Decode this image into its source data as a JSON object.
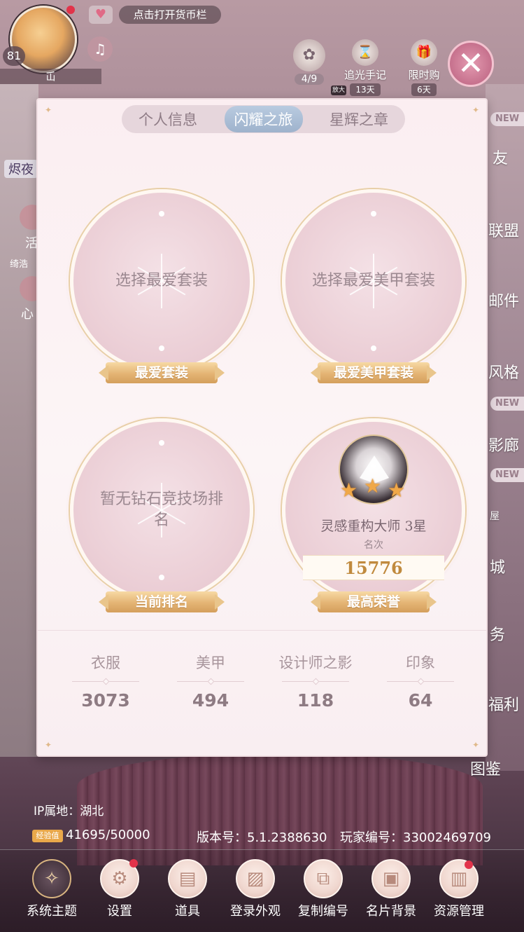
{
  "hud": {
    "level": "81",
    "player_name": "屲",
    "currency_button": "点击打开货币栏",
    "quest_count": "4/9",
    "zoom_label": "放大",
    "event1": {
      "label": "追光手记",
      "sub": "13天"
    },
    "event2": {
      "label": "限时购",
      "sub": "6天"
    }
  },
  "left_side": {
    "item1": "烬夜",
    "item2": "活",
    "item3": "绮浩",
    "item4": "心"
  },
  "right_side": {
    "items": [
      "友",
      "联盟",
      "邮件",
      "风格",
      "影廊",
      "屋",
      "城",
      "务",
      "福利",
      "图鉴"
    ],
    "new_tag": "NEW"
  },
  "tabs": {
    "personal": "个人信息",
    "journey": "闪耀之旅",
    "badges": "星辉之章"
  },
  "slots": {
    "favorite_suit": {
      "text": "选择最爱套装",
      "ribbon": "最爱套装"
    },
    "favorite_nail": {
      "text": "选择最爱美甲套装",
      "ribbon": "最爱美甲套装"
    },
    "current_rank": {
      "text": "暂无钻石竞技场排名",
      "ribbon": "当前排名"
    },
    "top_honor": {
      "title": "灵感重构大师 3星",
      "sub": "名次",
      "rank": "15776",
      "ribbon": "最高荣誉",
      "stars": 3
    }
  },
  "stats": [
    {
      "label": "衣服",
      "value": "3073"
    },
    {
      "label": "美甲",
      "value": "494"
    },
    {
      "label": "设计师之影",
      "value": "118"
    },
    {
      "label": "印象",
      "value": "64"
    }
  ],
  "footer": {
    "ip": "IP属地：湖北",
    "exp_badge": "经验值",
    "exp": "41695/50000",
    "version": "版本号：5.1.2388630",
    "player_id": "玩家编号：33002469709"
  },
  "bottom_bar": [
    {
      "label": "系统主题",
      "icon": "theme-icon"
    },
    {
      "label": "设置",
      "icon": "gear-icon"
    },
    {
      "label": "道具",
      "icon": "bag-icon"
    },
    {
      "label": "登录外观",
      "icon": "image-icon"
    },
    {
      "label": "复制编号",
      "icon": "copy-icon"
    },
    {
      "label": "名片背景",
      "icon": "card-icon"
    },
    {
      "label": "资源管理",
      "icon": "folder-icon"
    }
  ],
  "colors": {
    "accent_gold": "#e4b474",
    "tab_active": "#9eb2cc",
    "notify_red": "#e2334a"
  }
}
